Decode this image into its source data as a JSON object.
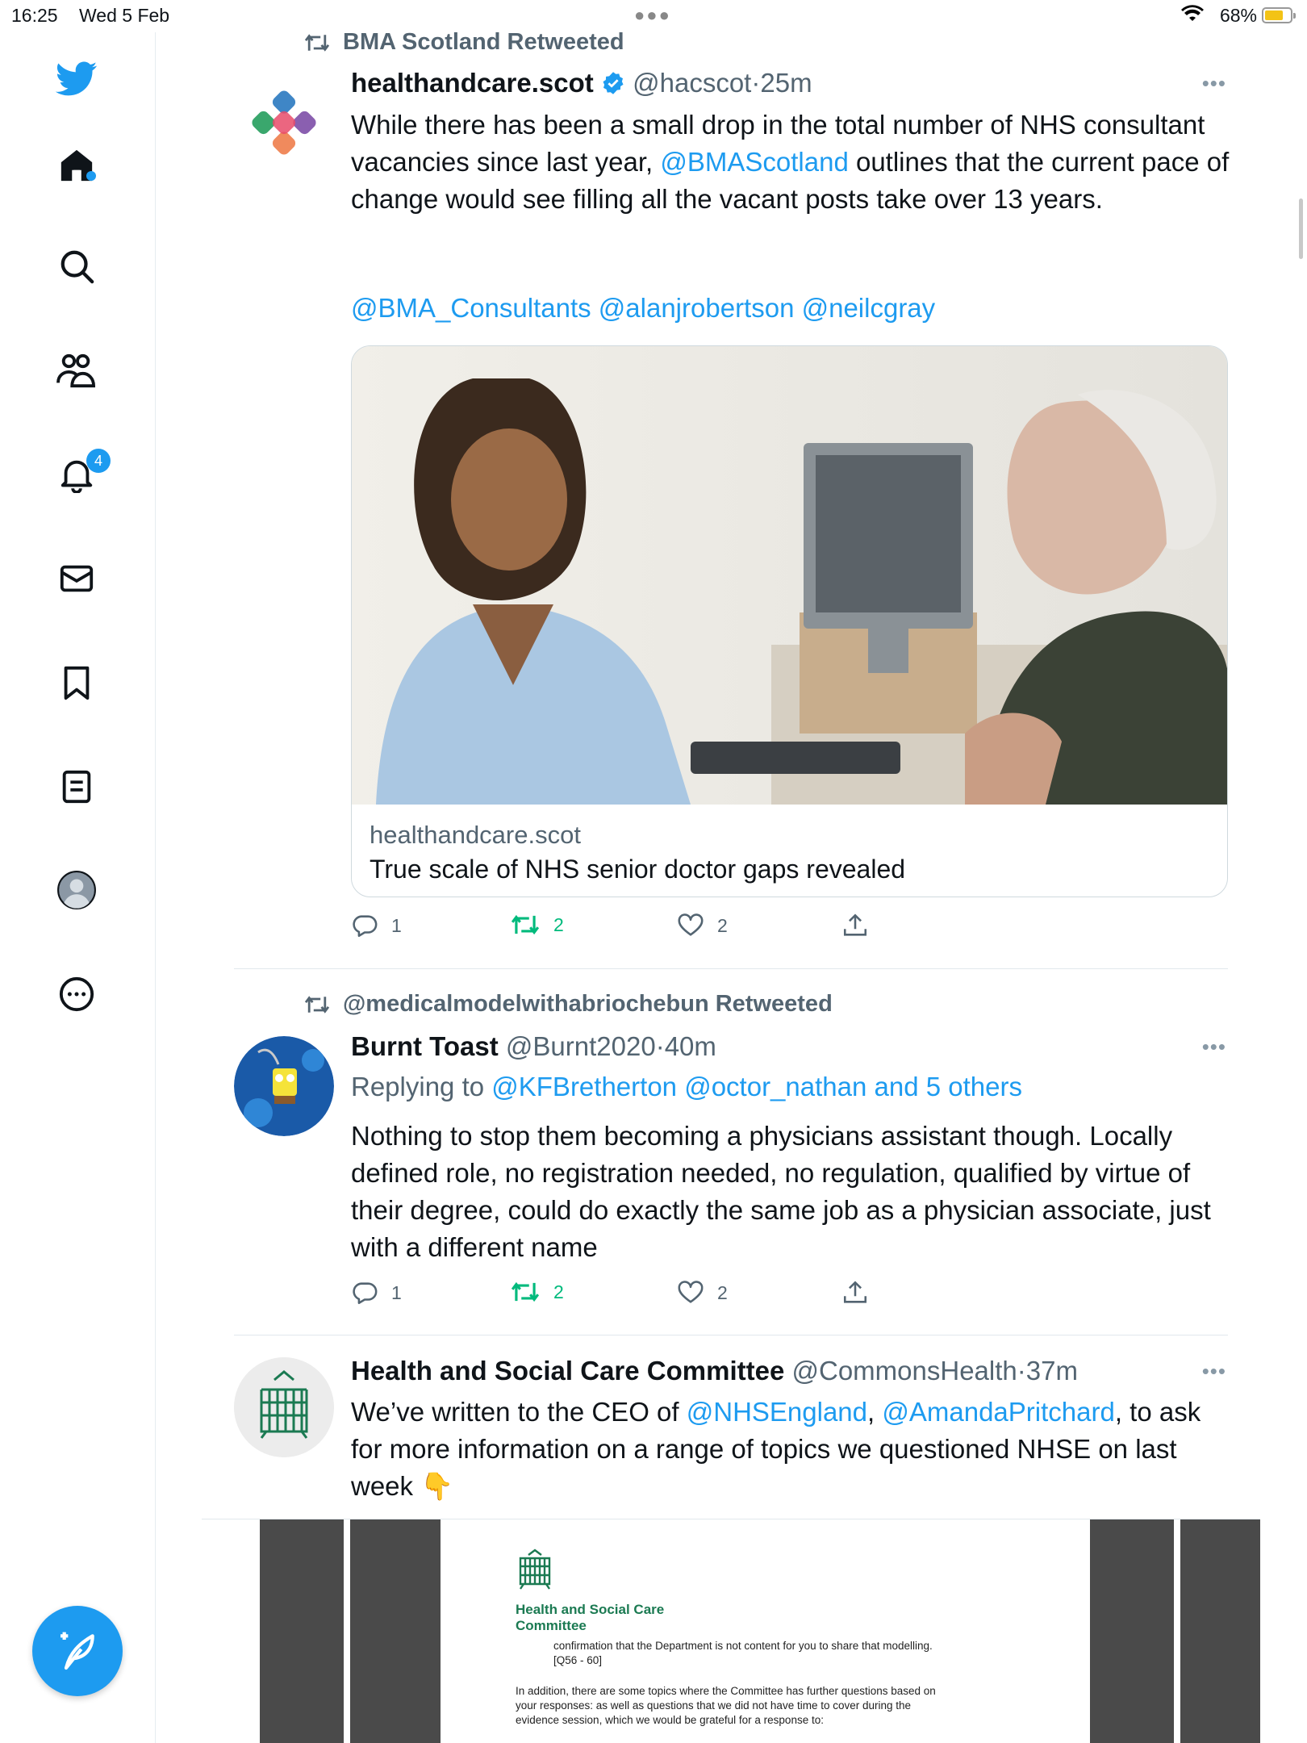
{
  "status_bar": {
    "time": "16:25",
    "date": "Wed 5 Feb",
    "battery": "68%"
  },
  "sidebar": {
    "notifications_count": "4",
    "items": [
      {
        "icon": "twitter-bird-icon"
      },
      {
        "icon": "home-icon"
      },
      {
        "icon": "search-icon"
      },
      {
        "icon": "communities-icon"
      },
      {
        "icon": "bell-icon"
      },
      {
        "icon": "mail-icon"
      },
      {
        "icon": "bookmark-icon"
      },
      {
        "icon": "lists-icon"
      },
      {
        "icon": "profile-icon"
      },
      {
        "icon": "more-icon"
      }
    ]
  },
  "tweets": [
    {
      "retweeted_by": "BMA Scotland Retweeted",
      "name": "healthandcare.scot",
      "handle": "@hacscot",
      "separator": "·",
      "time": "25m",
      "text_a": "While there has been a small drop in the total number of NHS consultant vacancies since last year, ",
      "mention_a": "@BMAScotland",
      "text_b": " outlines that the current pace of change would see filling all the vacant posts take over 13 years.",
      "mentions_line": "@BMA_Consultants @alanjrobertson @neilcgray",
      "card": {
        "domain": "healthandcare.scot",
        "title": "True scale of NHS senior doctor gaps revealed"
      },
      "replies": "1",
      "retweets": "2",
      "likes": "2"
    },
    {
      "retweeted_by": "@medicalmodelwithabriochebun Retweeted",
      "name": "Burnt Toast",
      "handle": "@Burnt2020",
      "separator": "·",
      "time": "40m",
      "replying_label": "Replying to ",
      "replying_to": "@KFBretherton @octor_nathan and 5 others",
      "text": "Nothing to stop them becoming a physicians assistant though. Locally defined role, no registration needed, no regulation, qualified by virtue of their degree, could do exactly the same job as a physician associate, just with a different name",
      "replies": "1",
      "retweets": "2",
      "likes": "2"
    },
    {
      "name": "Health and Social Care Committee",
      "handle": "@CommonsHealth",
      "separator": "·",
      "time": "37m",
      "text_a": "We’ve written to the CEO of ",
      "mention_a": "@NHSEngland",
      "comma": ", ",
      "mention_b": "@AmandaPritchard",
      "text_b": ", to ask for more information on a range of topics we questioned NHSE on last week ",
      "emoji": "👇",
      "document": {
        "org_line1": "Health and Social Care",
        "org_line2": "Committee",
        "lines": [
          "confirmation that the Department is not content for you to share that modelling.",
          "[Q56 - 60]",
          "In addition, there are some topics where the Committee has further questions based on",
          "your responses: as well as questions that we did not have time to cover during the",
          "evidence session, which we would be grateful for a response to:"
        ]
      }
    }
  ],
  "colors": {
    "accent": "#1d9bf0",
    "retweet_green": "#00ba7c",
    "muted": "#536471"
  }
}
